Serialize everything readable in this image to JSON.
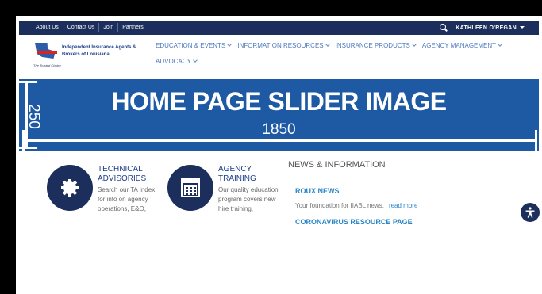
{
  "topbar": {
    "links": [
      "About Us",
      "Contact Us",
      "Join",
      "Partners"
    ],
    "user_name": "KATHLEEN O'REGAN"
  },
  "logo": {
    "name": "Independent Insurance Agents & Brokers of Louisiana",
    "tagline": "The Trusted Choice"
  },
  "nav": {
    "items": [
      "EDUCATION & EVENTS",
      "INFORMATION RESOURCES",
      "INSURANCE PRODUCTS",
      "AGENCY MANAGEMENT",
      "ADVOCACY"
    ]
  },
  "slider": {
    "title": "HOME PAGE SLIDER IMAGE",
    "width_label": "1850",
    "height_label": "250",
    "background": "#1d5aa3"
  },
  "cards": [
    {
      "title": "TECHNICAL ADVISORIES",
      "text": "Search our TA Index for info on agency operations, E&O,",
      "icon": "gear-icon"
    },
    {
      "title": "AGENCY TRAINING",
      "text": "Our quality education program covers new hire training,",
      "icon": "calendar-icon"
    }
  ],
  "news": {
    "heading": "NEWS & INFORMATION",
    "items": [
      {
        "title": "ROUX NEWS",
        "description": "Your foundation for IIABL news.",
        "more": "read more"
      },
      {
        "title": "CORONAVIRUS RESOURCE PAGE"
      }
    ]
  },
  "colors": {
    "navy": "#1c2f5c",
    "link_blue": "#2a86c6",
    "nav_blue": "#4f7ac0"
  }
}
